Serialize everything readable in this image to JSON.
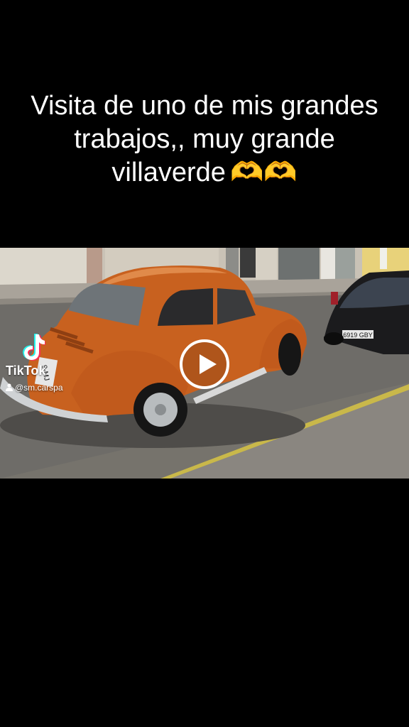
{
  "post": {
    "caption": "Visita de uno de mis grandes trabajos,, muy grande villaverde",
    "caption_emoji": "🫶🫶"
  },
  "video": {
    "plate_front": "9-MJ",
    "plate_other_car": "6919 GBY"
  },
  "watermark": {
    "brand": "TikTok",
    "handle": "@sm.carspa"
  },
  "colors": {
    "background": "#000000",
    "caption_text": "#ffffff",
    "car_orange": "#c8611f",
    "emoji": "#f2b51d"
  }
}
